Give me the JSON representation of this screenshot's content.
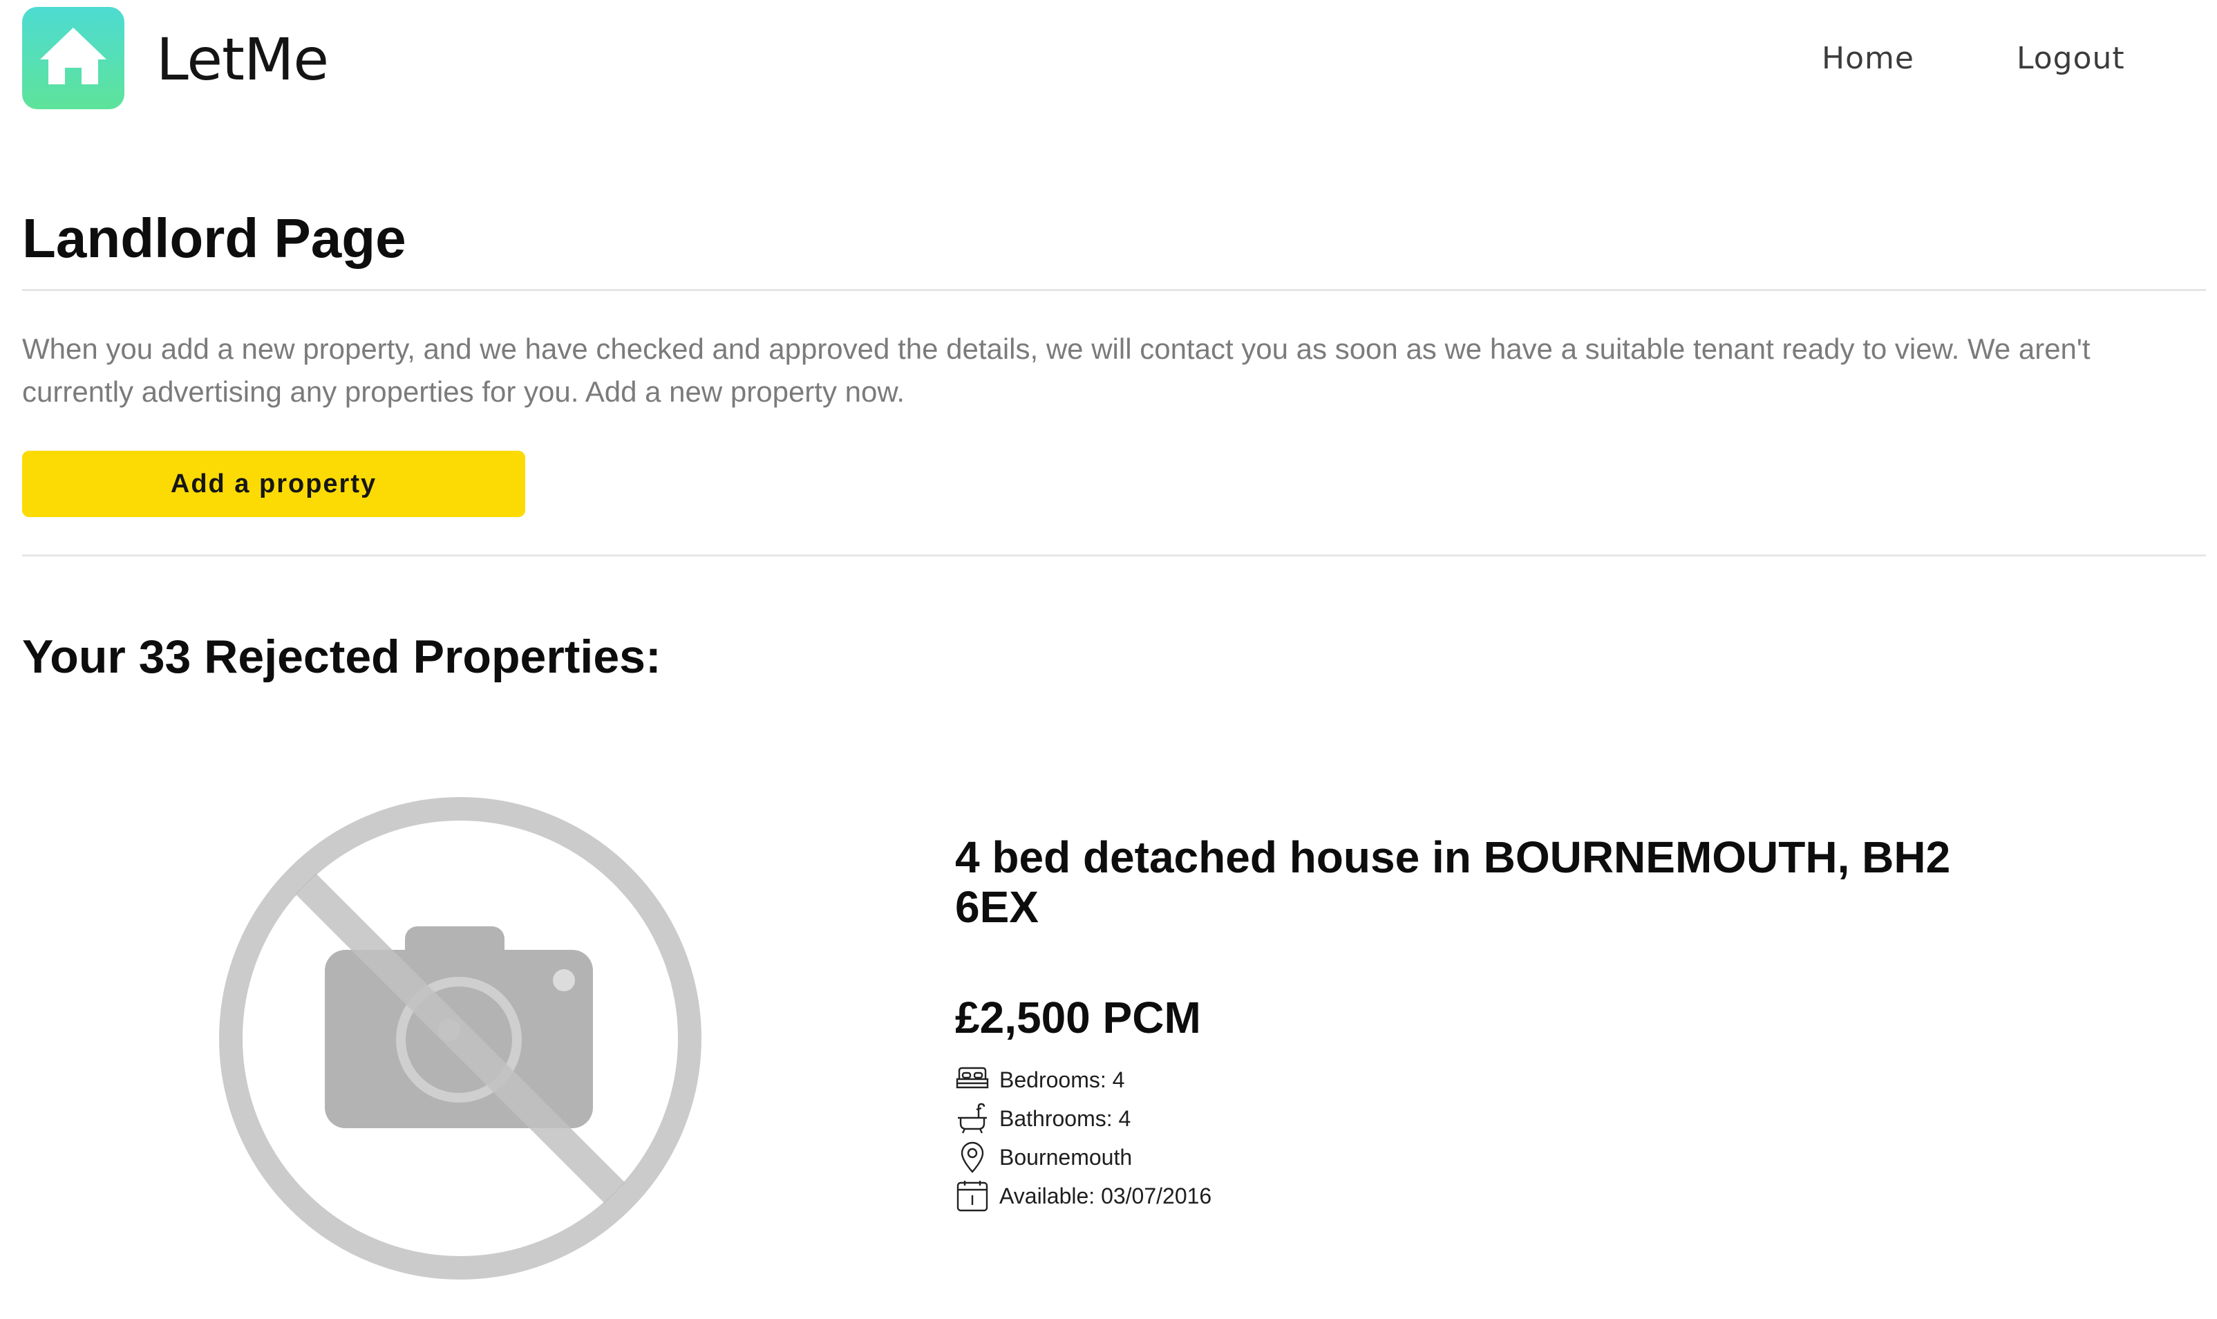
{
  "header": {
    "brand": "LetMe",
    "nav": {
      "home": "Home",
      "logout": "Logout"
    }
  },
  "page": {
    "title": "Landlord Page",
    "intro": "When you add a new property, and we have checked and approved the details, we will contact you as soon as we have a suitable tenant ready to view. We aren't currently advertising any properties for you. Add a new property now.",
    "add_button": "Add a property",
    "section_title": "Your 33 Rejected Properties:"
  },
  "property": {
    "title": "4 bed detached house in BOURNEMOUTH, BH2 6EX",
    "price": "£2,500 PCM",
    "bedrooms": "Bedrooms: 4",
    "bathrooms": "Bathrooms: 4",
    "location": "Bournemouth",
    "available": "Available: 03/07/2016",
    "image_icon": "no-photo-icon"
  },
  "colors": {
    "logo_gradient_top": "#4ddbd2",
    "logo_gradient_bottom": "#5ee39a",
    "button": "#fcdb04",
    "muted_text": "#7b7b7b",
    "rule": "#e6e6e6"
  }
}
